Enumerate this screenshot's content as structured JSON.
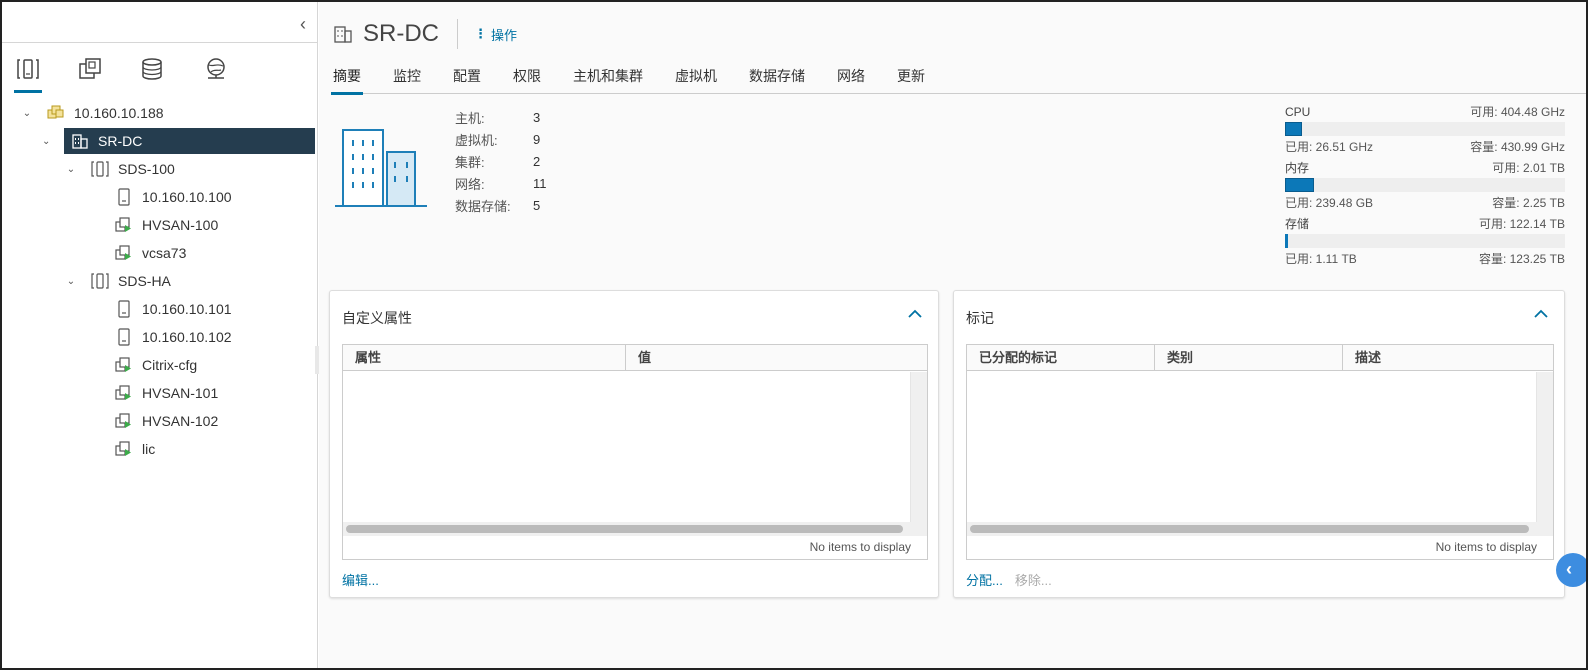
{
  "navigator": {
    "tabs": [
      {
        "icon": "hosts-clusters-icon"
      },
      {
        "icon": "vms-templates-icon"
      },
      {
        "icon": "storage-icon"
      },
      {
        "icon": "networking-icon"
      }
    ],
    "tree": [
      {
        "label": "10.160.10.188",
        "type": "vcenter",
        "level": 0,
        "expanded": true
      },
      {
        "label": "SR-DC",
        "type": "datacenter",
        "level": 1,
        "expanded": true,
        "selected": true
      },
      {
        "label": "SDS-100",
        "type": "cluster",
        "level": 2,
        "expanded": true
      },
      {
        "label": "10.160.10.100",
        "type": "host",
        "level": 3
      },
      {
        "label": "HVSAN-100",
        "type": "vm",
        "level": 3
      },
      {
        "label": "vcsa73",
        "type": "vm",
        "level": 3
      },
      {
        "label": "SDS-HA",
        "type": "cluster",
        "level": 2,
        "expanded": true
      },
      {
        "label": "10.160.10.101",
        "type": "host",
        "level": 3
      },
      {
        "label": "10.160.10.102",
        "type": "host",
        "level": 3
      },
      {
        "label": "Citrix-cfg",
        "type": "vm",
        "level": 3
      },
      {
        "label": "HVSAN-101",
        "type": "vm",
        "level": 3
      },
      {
        "label": "HVSAN-102",
        "type": "vm",
        "level": 3
      },
      {
        "label": "lic",
        "type": "vm",
        "level": 3
      }
    ]
  },
  "header": {
    "title": "SR-DC",
    "actions_label": "操作"
  },
  "tabs": [
    "摘要",
    "监控",
    "配置",
    "权限",
    "主机和集群",
    "虚拟机",
    "数据存储",
    "网络",
    "更新"
  ],
  "summary": {
    "stats": [
      {
        "label": "主机:",
        "value": "3"
      },
      {
        "label": "虚拟机:",
        "value": "9"
      },
      {
        "label": "集群:",
        "value": "2"
      },
      {
        "label": "网络:",
        "value": "11"
      },
      {
        "label": "数据存储:",
        "value": "5"
      }
    ],
    "resources": [
      {
        "name": "CPU",
        "free": "可用: 404.48 GHz",
        "used": "已用: 26.51 GHz",
        "capacity": "容量: 430.99 GHz",
        "used_fraction": 0.06
      },
      {
        "name": "内存",
        "free": "可用: 2.01 TB",
        "used": "已用: 239.48 GB",
        "capacity": "容量: 2.25 TB",
        "used_fraction": 0.104
      },
      {
        "name": "存储",
        "free": "可用: 122.14 TB",
        "used": "已用: 1.11 TB",
        "capacity": "容量: 123.25 TB",
        "used_fraction": 0.009
      }
    ]
  },
  "custom_attributes": {
    "title": "自定义属性",
    "columns": [
      "属性",
      "值"
    ],
    "empty_text": "No items to display",
    "edit_link": "编辑..."
  },
  "tags": {
    "title": "标记",
    "columns": [
      "已分配的标记",
      "类别",
      "描述"
    ],
    "empty_text": "No items to display",
    "assign_link": "分配...",
    "remove_link": "移除..."
  },
  "colors": {
    "accent": "#0072a3",
    "selected_row": "#253d4f",
    "bar_fill": "#0c78b8"
  }
}
